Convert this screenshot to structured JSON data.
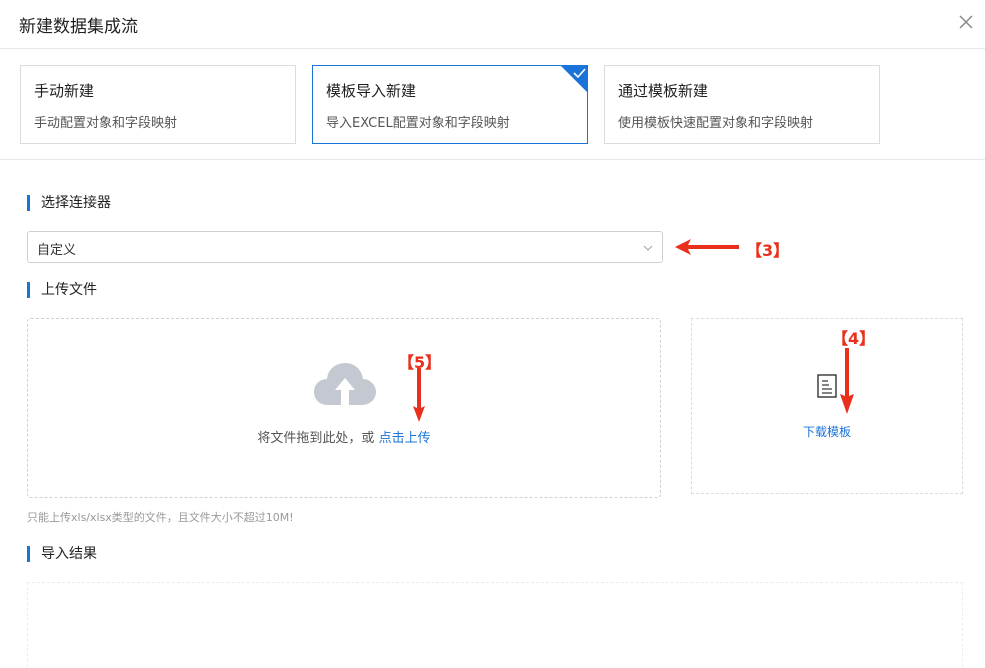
{
  "dialog": {
    "title": "新建数据集成流"
  },
  "modes": [
    {
      "title": "手动新建",
      "desc": "手动配置对象和字段映射",
      "selected": false
    },
    {
      "title": "模板导入新建",
      "desc": "导入EXCEL配置对象和字段映射",
      "selected": true
    },
    {
      "title": "通过模板新建",
      "desc": "使用模板快速配置对象和字段映射",
      "selected": false
    }
  ],
  "connector": {
    "label": "选择连接器",
    "value": "自定义"
  },
  "upload": {
    "label": "上传文件",
    "hint_prefix": "将文件拖到此处，或",
    "hint_link": "点击上传",
    "note": "只能上传xls/xlsx类型的文件，且文件大小不超过10M!",
    "template_link": "下载模板"
  },
  "result": {
    "label": "导入结果"
  },
  "annotations": {
    "a3": "【3】",
    "a4": "【4】",
    "a5": "【5】"
  },
  "colors": {
    "accent": "#1a73d9",
    "annotation": "#e8301c",
    "cloud": "#c4c8d0"
  },
  "icons": {
    "close": "close-icon",
    "check": "check-icon",
    "chevron": "chevron-down-icon",
    "cloud": "cloud-upload-icon",
    "document": "document-icon"
  }
}
